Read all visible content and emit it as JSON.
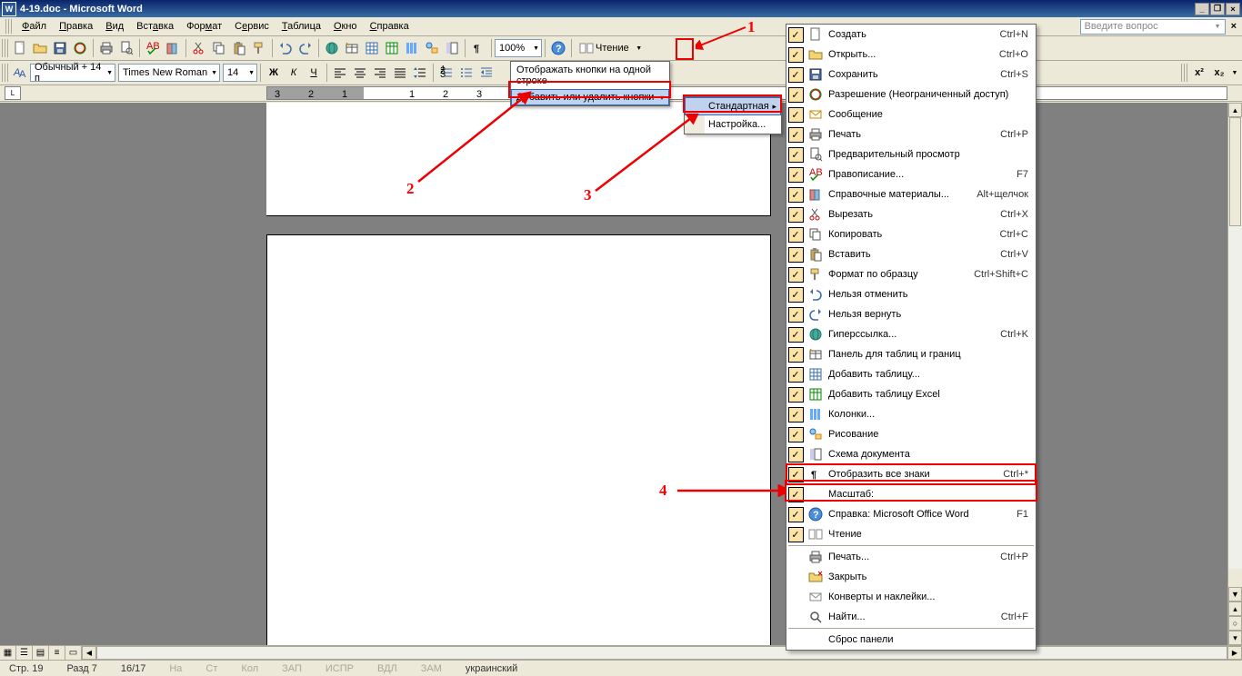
{
  "title": "4-19.doc - Microsoft Word",
  "question_placeholder": "Введите вопрос",
  "menubar": [
    "Файл",
    "Правка",
    "Вид",
    "Вставка",
    "Формат",
    "Сервис",
    "Таблица",
    "Окно",
    "Справка"
  ],
  "toolbar1": {
    "zoom": "100%",
    "reading": "Чтение"
  },
  "toolbar2": {
    "style": "Обычный + 14 п",
    "font": "Times New Roman",
    "size": "14"
  },
  "dropdown1": {
    "show_one_row": "Отображать кнопки на одной строке",
    "add_remove": "Добавить или удалить кнопки"
  },
  "submenu2": {
    "standard": "Стандартная",
    "customize": "Настройка..."
  },
  "customize_items": [
    {
      "label": "Создать",
      "shortcut": "Ctrl+N",
      "checked": true,
      "icon": "new"
    },
    {
      "label": "Открыть...",
      "shortcut": "Ctrl+O",
      "checked": true,
      "icon": "open"
    },
    {
      "label": "Сохранить",
      "shortcut": "Ctrl+S",
      "checked": true,
      "icon": "save"
    },
    {
      "label": "Разрешение (Неограниченный доступ)",
      "shortcut": "",
      "checked": true,
      "icon": "permission"
    },
    {
      "label": "Сообщение",
      "shortcut": "",
      "checked": true,
      "icon": "mail"
    },
    {
      "label": "Печать",
      "shortcut": "Ctrl+P",
      "checked": true,
      "icon": "print"
    },
    {
      "label": "Предварительный просмотр",
      "shortcut": "",
      "checked": true,
      "icon": "preview"
    },
    {
      "label": "Правописание...",
      "shortcut": "F7",
      "checked": true,
      "icon": "spell"
    },
    {
      "label": "Справочные материалы...",
      "shortcut": "Alt+щелчок",
      "checked": true,
      "icon": "research"
    },
    {
      "label": "Вырезать",
      "shortcut": "Ctrl+X",
      "checked": true,
      "icon": "cut"
    },
    {
      "label": "Копировать",
      "shortcut": "Ctrl+C",
      "checked": true,
      "icon": "copy"
    },
    {
      "label": "Вставить",
      "shortcut": "Ctrl+V",
      "checked": true,
      "icon": "paste"
    },
    {
      "label": "Формат по образцу",
      "shortcut": "Ctrl+Shift+C",
      "checked": true,
      "icon": "format-painter"
    },
    {
      "label": "Нельзя отменить",
      "shortcut": "",
      "checked": true,
      "icon": "undo"
    },
    {
      "label": "Нельзя вернуть",
      "shortcut": "",
      "checked": true,
      "icon": "redo"
    },
    {
      "label": "Гиперссылка...",
      "shortcut": "Ctrl+K",
      "checked": true,
      "icon": "hyperlink"
    },
    {
      "label": "Панель для таблиц и границ",
      "shortcut": "",
      "checked": true,
      "icon": "tables-borders"
    },
    {
      "label": "Добавить таблицу...",
      "shortcut": "",
      "checked": true,
      "icon": "insert-table"
    },
    {
      "label": "Добавить таблицу Excel",
      "shortcut": "",
      "checked": true,
      "icon": "insert-excel"
    },
    {
      "label": "Колонки...",
      "shortcut": "",
      "checked": true,
      "icon": "columns"
    },
    {
      "label": "Рисование",
      "shortcut": "",
      "checked": true,
      "icon": "drawing"
    },
    {
      "label": "Схема документа",
      "shortcut": "",
      "checked": true,
      "icon": "doc-map"
    },
    {
      "label": "Отобразить все знаки",
      "shortcut": "Ctrl+*",
      "checked": true,
      "icon": "pilcrow",
      "hl": true
    },
    {
      "label": "Масштаб:",
      "shortcut": "",
      "checked": true,
      "icon": ""
    },
    {
      "label": "Справка: Microsoft Office Word",
      "shortcut": "F1",
      "checked": true,
      "icon": "help"
    },
    {
      "label": "Чтение",
      "shortcut": "",
      "checked": true,
      "icon": "reading"
    }
  ],
  "customize_bottom": [
    {
      "label": "Печать...",
      "shortcut": "Ctrl+P",
      "icon": "print"
    },
    {
      "label": "Закрыть",
      "shortcut": "",
      "icon": "close-folder"
    },
    {
      "label": "Конверты и наклейки...",
      "shortcut": "",
      "icon": "envelope"
    },
    {
      "label": "Найти...",
      "shortcut": "Ctrl+F",
      "icon": "find"
    }
  ],
  "reset_panel": "Сброс панели",
  "statusbar": {
    "page": "Стр. 19",
    "section": "Разд 7",
    "pages": "16/17",
    "at": "На",
    "ln": "Ст",
    "col": "Кол",
    "rec": "ЗАП",
    "trk": "ИСПР",
    "ext": "ВДЛ",
    "ovr": "ЗАМ",
    "lang": "украинский"
  },
  "annotations": {
    "a1": "1",
    "a2": "2",
    "a3": "3",
    "a4": "4"
  }
}
